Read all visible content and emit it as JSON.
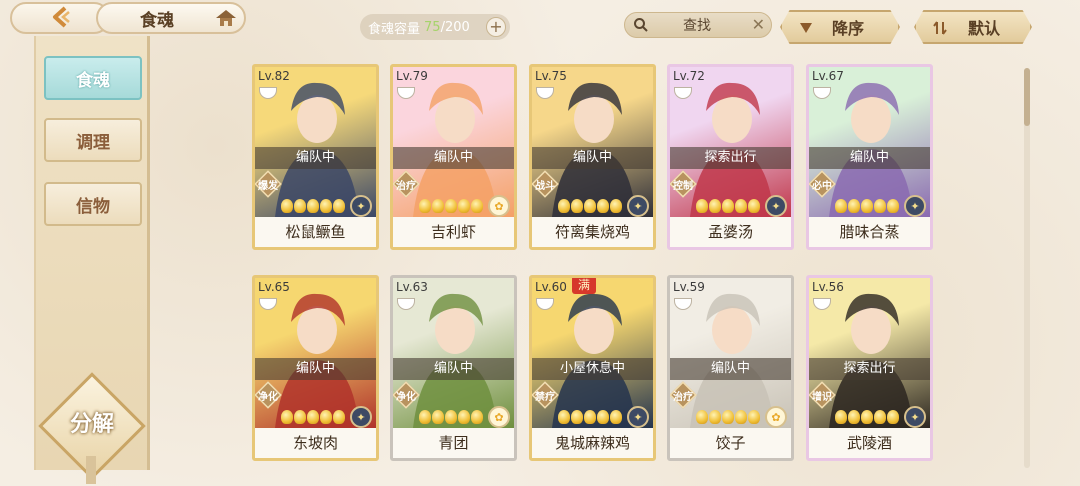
{
  "header": {
    "title": "食魂",
    "capacity_label": "食魂容量",
    "capacity_current": "75",
    "capacity_total": "/200",
    "capacity_add": "+",
    "search_label": "查找",
    "search_clear": "✕",
    "sort_order": "降序",
    "sort_mode": "默认"
  },
  "sidebar": {
    "tabs": [
      {
        "label": "食魂",
        "active": true
      },
      {
        "label": "调理",
        "active": false
      },
      {
        "label": "信物",
        "active": false
      }
    ],
    "decompose_label": "分解"
  },
  "cards": [
    {
      "level": "Lv.82",
      "status": "编队中",
      "role": "爆发",
      "stars": 5,
      "name": "松鼠鳜鱼",
      "frame": "gold",
      "element": "moon",
      "bg": [
        "#f6d97a",
        "#3b4766"
      ]
    },
    {
      "level": "Lv.79",
      "status": "编队中",
      "role": "治疗",
      "stars": 5,
      "name": "吉利虾",
      "frame": "gold",
      "element": "sun",
      "bg": [
        "#fbd5dd",
        "#f4a166"
      ]
    },
    {
      "level": "Lv.75",
      "status": "编队中",
      "role": "战斗",
      "stars": 5,
      "name": "符离集烧鸡",
      "frame": "gold",
      "element": "moon",
      "bg": [
        "#f6d78a",
        "#2e2e38"
      ]
    },
    {
      "level": "Lv.72",
      "status": "探索出行",
      "role": "控制",
      "stars": 5,
      "name": "孟婆汤",
      "frame": "rainbow",
      "element": "moon",
      "bg": [
        "#f0d6f0",
        "#c0374a"
      ]
    },
    {
      "level": "Lv.67",
      "status": "编队中",
      "role": "必中",
      "stars": 5,
      "name": "腊味合蒸",
      "frame": "rainbow",
      "element": "moon",
      "bg": [
        "#d9f0d8",
        "#8a6ab0"
      ]
    },
    {
      "level": "Lv.65",
      "status": "编队中",
      "role": "净化",
      "stars": 5,
      "name": "东坡肉",
      "frame": "gold",
      "element": "moon",
      "bg": [
        "#f6d770",
        "#b0322a"
      ]
    },
    {
      "level": "Lv.63",
      "status": "编队中",
      "role": "净化",
      "stars": 5,
      "name": "青团",
      "frame": "silver",
      "element": "sun",
      "bg": [
        "#e6e8d4",
        "#6f8f3e"
      ]
    },
    {
      "level": "Lv.60",
      "status": "小屋休息中",
      "role": "禁疗",
      "stars": 5,
      "name": "鬼城麻辣鸡",
      "frame": "gold",
      "element": "moon",
      "bg": [
        "#f6d770",
        "#24344e"
      ],
      "full": "满"
    },
    {
      "level": "Lv.59",
      "status": "编队中",
      "role": "治疗",
      "stars": 5,
      "name": "饺子",
      "frame": "silver",
      "element": "sun",
      "bg": [
        "#f1ede4",
        "#c8c2b6"
      ]
    },
    {
      "level": "Lv.56",
      "status": "探索出行",
      "role": "增识",
      "stars": 5,
      "name": "武陵酒",
      "frame": "rainbow",
      "element": "moon",
      "bg": [
        "#f5e9a8",
        "#2c2620"
      ]
    }
  ]
}
